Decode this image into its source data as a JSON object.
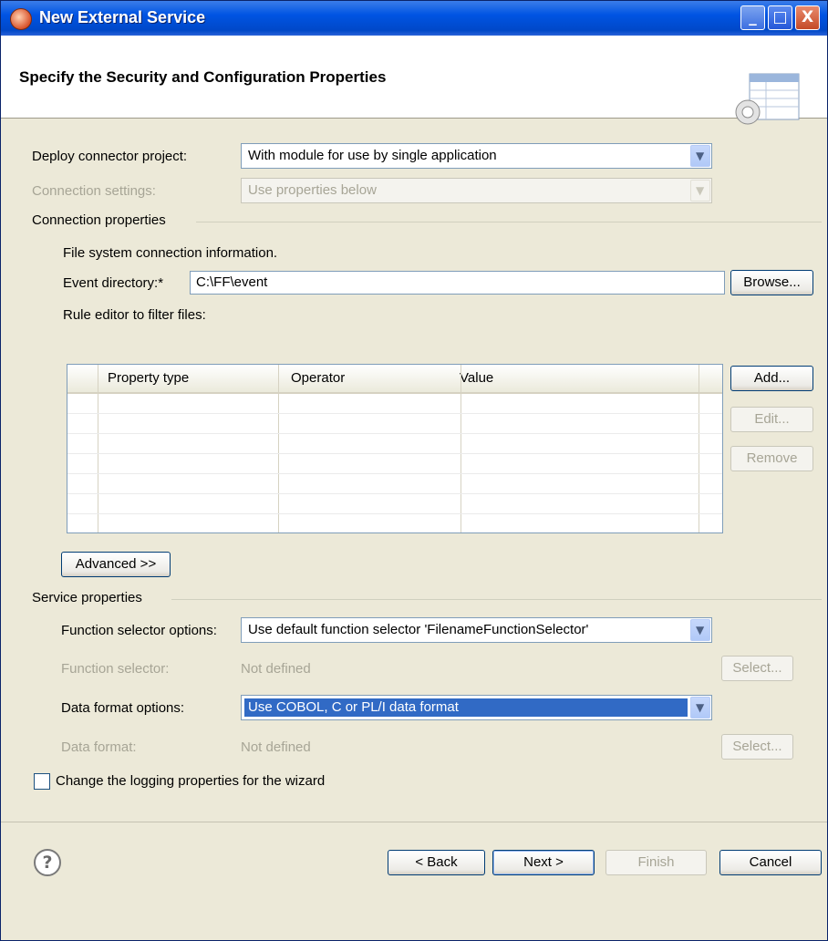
{
  "window": {
    "title": "New External Service",
    "controls": {
      "minimize": "_",
      "maximize": "□",
      "close": "X"
    }
  },
  "header": {
    "title": "Specify the Security and Configuration Properties",
    "icon": "wizard-banner-icon"
  },
  "deploy": {
    "label": "Deploy connector project:",
    "value": "With module for use by single application"
  },
  "connection_settings": {
    "label": "Connection settings:",
    "value": "Use properties below"
  },
  "connection_properties": {
    "group_label": "Connection properties",
    "info": "File system connection information.",
    "event_dir_label": "Event directory:",
    "event_dir_required": "*",
    "event_dir_value": "C:\\FF\\event",
    "browse": "Browse...",
    "rule_editor_label": "Rule editor to filter files:",
    "table": {
      "columns": [
        "Property type",
        "Operator",
        "Value"
      ],
      "rows": []
    },
    "add": "Add...",
    "edit": "Edit...",
    "remove": "Remove",
    "advanced": "Advanced >>"
  },
  "service_properties": {
    "group_label": "Service properties",
    "function_selector_options_label": "Function selector options:",
    "function_selector_options_value": "Use default function selector 'FilenameFunctionSelector'",
    "function_selector_label": "Function selector:",
    "function_selector_value": "Not defined",
    "function_select_button": "Select...",
    "data_format_options_label": "Data format options:",
    "data_format_options_value": "Use COBOL, C or PL/I data format",
    "data_format_label": "Data format:",
    "data_format_value": "Not defined",
    "data_format_select_button": "Select..."
  },
  "logging_checkbox": {
    "label": "Change the logging properties for the wizard",
    "checked": false
  },
  "footer": {
    "help": "?",
    "back": "< Back",
    "next": "Next >",
    "finish": "Finish",
    "cancel": "Cancel"
  },
  "colors": {
    "titlebar": "#0054e3",
    "dialog_bg": "#ece9d8",
    "selection": "#316ac5",
    "disabled_text": "#a7a596"
  }
}
